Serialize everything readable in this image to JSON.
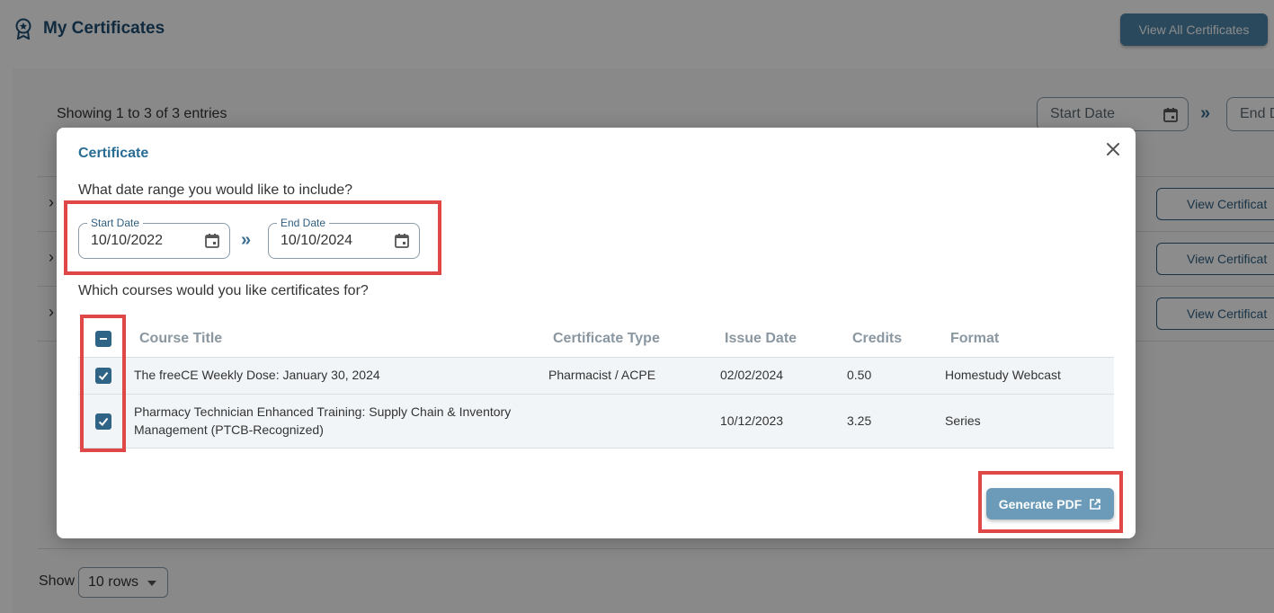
{
  "header": {
    "title": "My Certificates",
    "view_all_label": "View All Certificates"
  },
  "list": {
    "showing_text": "Showing 1 to 3 of 3 entries",
    "start_date_placeholder": "Start Date",
    "end_date_placeholder": "End D",
    "view_certificate_labels": [
      "View Certificat",
      "View Certificat",
      "View Certificat"
    ],
    "show_label": "Show",
    "rows_value": "10 rows"
  },
  "modal": {
    "title": "Certificate",
    "date_question": "What date range you would like to include?",
    "start_date": {
      "label": "Start Date",
      "value": "10/10/2022"
    },
    "end_date": {
      "label": "End Date",
      "value": "10/10/2024"
    },
    "range_separator": "»",
    "courses_question": "Which courses would you like certificates for?",
    "columns": {
      "course_title": "Course Title",
      "certificate_type": "Certificate Type",
      "issue_date": "Issue Date",
      "credits": "Credits",
      "format": "Format"
    },
    "rows": [
      {
        "checked": true,
        "course_title_line1": "The freeCE Weekly Dose: January 30, 2024",
        "course_title_line2": "",
        "certificate_type": "Pharmacist / ACPE",
        "issue_date": "02/02/2024",
        "credits": "0.50",
        "format": "Homestudy Webcast"
      },
      {
        "checked": true,
        "course_title_line1": "Pharmacy Technician Enhanced Training: Supply Chain & Inventory",
        "course_title_line2": "Management (PTCB-Recognized)",
        "certificate_type": "",
        "issue_date": "10/12/2023",
        "credits": "3.25",
        "format": "Series"
      }
    ],
    "generate_label": "Generate PDF"
  },
  "colors": {
    "primary": "#2f6486",
    "highlight": "#e04848",
    "generate_button": "#6b9bb8"
  },
  "icons": [
    "certificate-badge-icon",
    "calendar-icon",
    "close-icon",
    "external-link-icon",
    "chevron-right-icon",
    "indeterminate-checkbox-icon",
    "checkmark-icon"
  ]
}
